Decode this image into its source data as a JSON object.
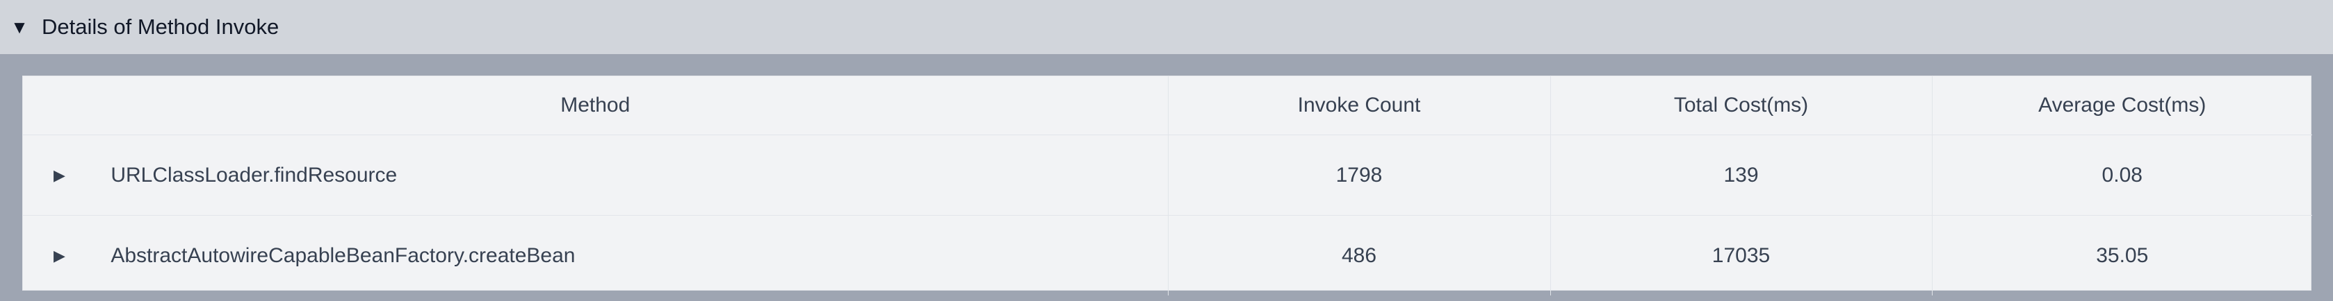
{
  "section": {
    "toggle_icon": "▼",
    "title": "Details of Method Invoke"
  },
  "table": {
    "columns": [
      "Method",
      "Invoke Count",
      "Total Cost(ms)",
      "Average Cost(ms)"
    ],
    "rows": [
      {
        "toggle_icon": "▶",
        "method": "URLClassLoader.findResource",
        "invoke_count": "1798",
        "total_cost": "139",
        "average_cost": "0.08"
      },
      {
        "toggle_icon": "▶",
        "method": "AbstractAutowireCapableBeanFactory.createBean",
        "invoke_count": "486",
        "total_cost": "17035",
        "average_cost": "35.05"
      }
    ]
  },
  "colors": {
    "header_bg": "#d1d5db",
    "content_bg": "#9ea5b2",
    "table_bg": "#f2f3f5",
    "text": "#374151"
  }
}
